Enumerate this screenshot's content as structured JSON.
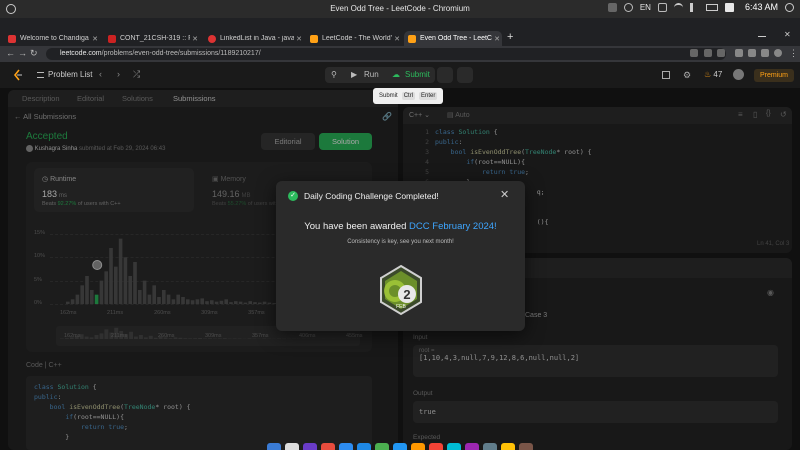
{
  "os": {
    "window_title": "Even Odd Tree - LeetCode - Chromium",
    "lang": "EN",
    "clock": "6:43 AM"
  },
  "tabs": [
    {
      "label": "Welcome to Chandiga",
      "fav_color": "#d33"
    },
    {
      "label": "CONT_21CSH-319 :: Pl",
      "fav_color": "#c22"
    },
    {
      "label": "LinkedList in Java - java",
      "fav_color": "#d33"
    },
    {
      "label": "LeetCode - The World's",
      "fav_color": "#ffa116"
    },
    {
      "label": "Even Odd Tree - LeetC",
      "fav_color": "#ffa116"
    }
  ],
  "new_tab": "+",
  "url": {
    "host": "leetcode.com",
    "path": "/problems/even-odd-tree/submissions/1189210217/"
  },
  "nav": {
    "problem_list": "Problem List",
    "run": "Run",
    "submit": "Submit",
    "streak": "47",
    "premium": "Premium"
  },
  "tooltip": {
    "label": "Submit",
    "key1": "Ctrl",
    "key2": "Enter"
  },
  "left_tabs": [
    "Description",
    "Editorial",
    "Solutions",
    "Submissions"
  ],
  "all_submissions": "All Submissions",
  "result": {
    "status": "Accepted",
    "author": "Kushagra Sinha",
    "submitted": "submitted at Feb 29, 2024 06:43",
    "editorial_btn": "Editorial",
    "solution_btn": "Solution"
  },
  "runtime": {
    "title": "Runtime",
    "value": "183",
    "unit": "ms",
    "beats_label": "Beats",
    "beats": "92.27%",
    "suffix": "of users with C++"
  },
  "memory": {
    "title": "Memory",
    "value": "149.16",
    "unit": "MB",
    "beats_label": "Beats",
    "beats": "55.27%",
    "suffix": "of users with C++"
  },
  "chart_data": {
    "type": "bar",
    "ylabels": [
      "15%",
      "10%",
      "5%",
      "0%"
    ],
    "xlabels": [
      "162ms",
      "211ms",
      "260ms",
      "309ms",
      "357ms",
      "406ms",
      "455ms"
    ],
    "slider_labels": [
      "162ms",
      "211ms",
      "260ms",
      "309ms",
      "357ms",
      "406ms",
      "455ms"
    ],
    "ylim": [
      0,
      15
    ],
    "values": [
      0.5,
      1,
      2,
      4,
      6,
      3,
      2,
      5,
      7,
      12,
      8,
      14,
      10,
      6,
      9,
      3,
      5,
      2,
      4,
      1.5,
      3,
      2,
      1,
      2,
      1.5,
      1,
      0.8,
      1,
      1.2,
      0.6,
      0.8,
      0.5,
      0.7,
      1,
      0.4,
      0.6,
      0.5,
      0.3,
      0.6,
      0.4,
      0.3,
      0.5,
      0.3,
      0.2,
      0.4,
      0.3,
      0.2,
      0.3,
      0.2,
      0.3,
      0.2,
      0.2,
      0.1,
      0.2,
      0.1,
      0.2,
      0.1,
      0.1,
      0.2,
      0.1
    ],
    "highlight_index": 6
  },
  "code_label": "Code",
  "code_lang": "C++",
  "left_code": [
    "class Solution {",
    "public:",
    "    bool isEvenOddTree(TreeNode* root) {",
    "        if(root==NULL){",
    "            return true;",
    "        }"
  ],
  "editor": {
    "lang": "C++",
    "auto": "Auto",
    "lines": [
      {
        "n": "1",
        "t": "class Solution {"
      },
      {
        "n": "2",
        "t": "public:"
      },
      {
        "n": "3",
        "t": "    bool isEvenOddTree(TreeNode* root) {"
      },
      {
        "n": "4",
        "t": "        if(root==NULL){"
      },
      {
        "n": "5",
        "t": "            return true;"
      },
      {
        "n": "6",
        "t": "        }"
      },
      {
        "n": "7",
        "t": "                          q;"
      },
      {
        "n": "8",
        "t": ""
      },
      {
        "n": "9",
        "t": ""
      },
      {
        "n": "10",
        "t": "                          (){"
      }
    ],
    "lncol": "Ln 41, Col 3"
  },
  "testcase": {
    "case": "Case 3",
    "input_label": "Input",
    "root_label": "root =",
    "root_value": "[1,10,4,3,null,7,9,12,8,6,null,null,2]",
    "output_label": "Output",
    "output_value": "true",
    "expected_label": "Expected"
  },
  "modal": {
    "title": "Daily Coding Challenge Completed!",
    "award_prefix": "You have been awarded",
    "award_name": "DCC February 2024!",
    "subtitle": "Consistency is key, see you next month!",
    "badge_number": "2",
    "badge_month": "FEB"
  },
  "colors": {
    "accent_green": "#2cbb5d",
    "brand_orange": "#ffa116",
    "link_blue": "#3ea6ff"
  }
}
